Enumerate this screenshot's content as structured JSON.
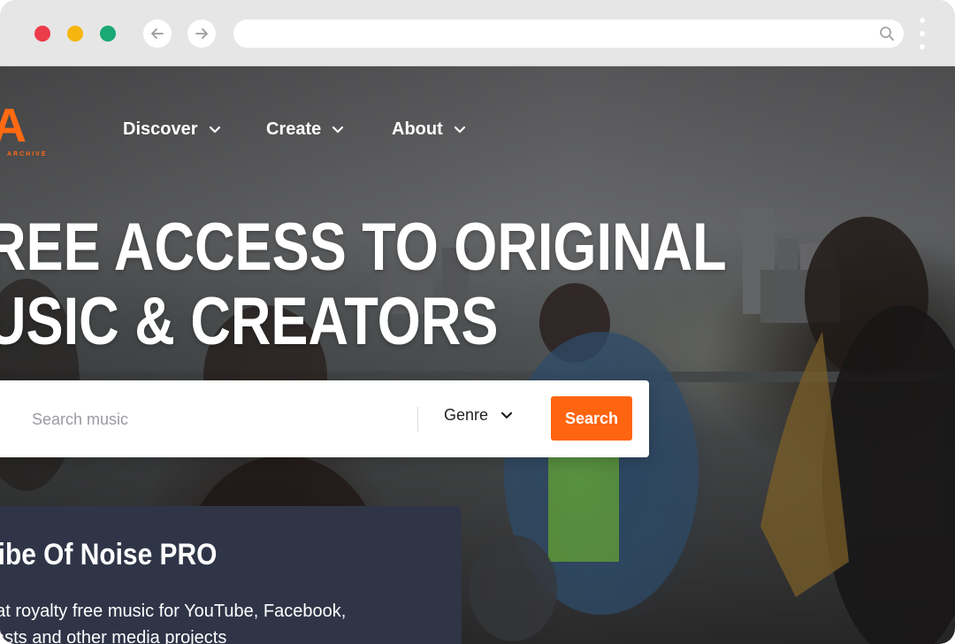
{
  "browser": {
    "url_value": "",
    "icons": {
      "back": "arrow-left-icon",
      "forward": "arrow-right-icon",
      "search": "search-icon",
      "menu": "kebab-menu-icon"
    },
    "colors": {
      "close": "#ec3c4b",
      "minimize": "#f5b60f",
      "maximize": "#1aa874"
    }
  },
  "site": {
    "logo_text": "IA",
    "logo_subtext": "ARCHIVE",
    "nav": [
      {
        "label": "Discover"
      },
      {
        "label": "Create"
      },
      {
        "label": "About"
      }
    ],
    "headline_line1": "REE ACCESS TO ORIGINAL",
    "headline_line2": "USIC & CREATORS",
    "search": {
      "placeholder": "Search music",
      "genre_label": "Genre",
      "button_label": "Search"
    },
    "promo": {
      "title": "ribe Of Noise PRO",
      "text_line1": "eat royalty free music for YouTube, Facebook,",
      "text_line2": "casts and other media projects"
    },
    "colors": {
      "accent": "#ff6410",
      "card": "#2f3547"
    }
  }
}
